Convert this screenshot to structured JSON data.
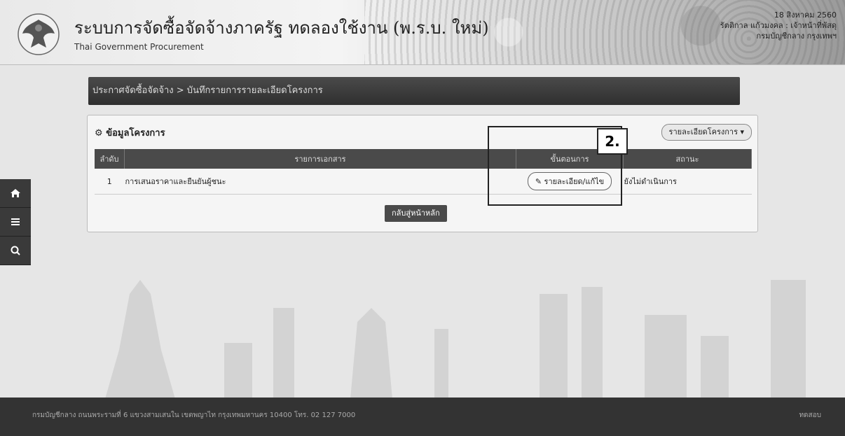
{
  "header": {
    "title": "ระบบการจัดซื้อจัดจ้างภาครัฐ ทดลองใช้งาน (พ.ร.บ. ใหม่)",
    "subtitle": "Thai Government Procurement",
    "date": "18 สิงหาคม 2560",
    "user": "รัตติกาล แก้วมงคล : เจ้าหน้าที่พัสดุ",
    "org": "กรมบัญชีกลาง กรุงเทพฯ"
  },
  "sidebar": {
    "items": [
      {
        "icon": "home-icon"
      },
      {
        "icon": "menu-icon"
      },
      {
        "icon": "search-icon"
      }
    ]
  },
  "page_title": "ประกาศจัดซื้อจัดจ้าง > บันทึกรายการรายละเอียดโครงการ",
  "project": {
    "heading": "ข้อมูลโครงการ",
    "dropdown_label": "รายละเอียดโครงการ ▾",
    "columns": [
      "ลำดับ",
      "รายการเอกสาร",
      "ขั้นตอนการ",
      "สถานะ"
    ],
    "rows": [
      {
        "no": "1",
        "doc": "การเสนอราคาและยืนยันผู้ชนะ",
        "action": "รายละเอียด/แก้ไข",
        "status": "ยังไม่ดำเนินการ"
      }
    ],
    "back_label": "กลับสู่หน้าหลัก"
  },
  "annotation": {
    "label": "2."
  },
  "footer": {
    "address": "กรมบัญชีกลาง ถนนพระรามที่ 6 แขวงสามเสนใน เขตพญาไท กรุงเทพมหานคร 10400 โทร. 02 127 7000",
    "version": "ทดสอบ"
  }
}
